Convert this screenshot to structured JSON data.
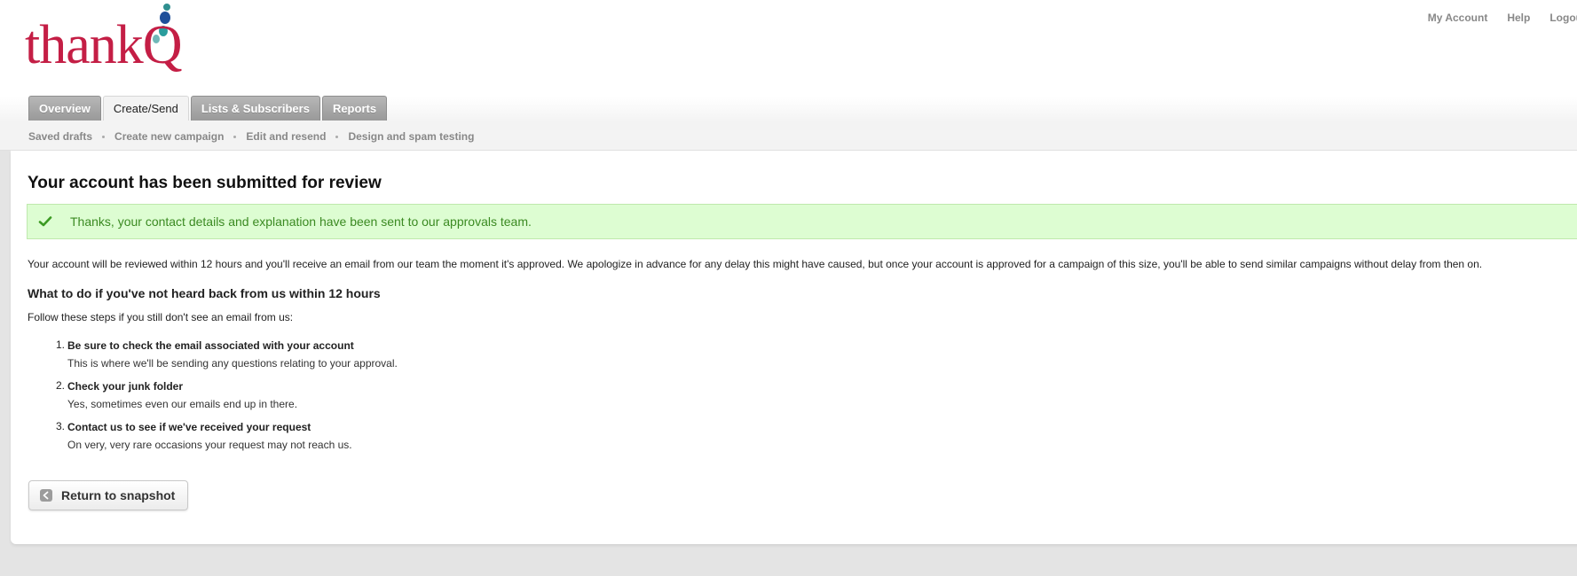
{
  "header": {
    "logo_text": "thankQ",
    "utility_nav": [
      "My Account",
      "Help",
      "Logout"
    ]
  },
  "tabs": [
    {
      "label": "Overview",
      "active": false
    },
    {
      "label": "Create/Send",
      "active": true
    },
    {
      "label": "Lists & Subscribers",
      "active": false
    },
    {
      "label": "Reports",
      "active": false
    }
  ],
  "subnav": [
    "Saved drafts",
    "Create new campaign",
    "Edit and resend",
    "Design and spam testing"
  ],
  "main": {
    "title": "Your account has been submitted for review",
    "success_message": "Thanks, your contact details and explanation have been sent to our approvals team.",
    "intro": "Your account will be reviewed within 12 hours and you'll receive an email from our team the moment it's approved. We apologize in advance for any delay this might have caused, but once your account is approved for a campaign of this size, you'll be able to send similar campaigns without delay from then on.",
    "subheading": "What to do if you've not heard back from us within 12 hours",
    "steps_intro": "Follow these steps if you still don't see an email from us:",
    "steps": [
      {
        "number": "1",
        "title": "Be sure to check the email associated with your account",
        "description": "This is where we'll be sending any questions relating to your approval."
      },
      {
        "number": "2",
        "title": "Check your junk folder",
        "description": "Yes, sometimes even our emails end up in there."
      },
      {
        "number": "3",
        "title": "Contact us to see if we've received your request",
        "description": "On very, very rare occasions your request may not reach us."
      }
    ],
    "return_button_label": "Return to snapshot"
  },
  "colors": {
    "brand": "#c41e45",
    "success_bg": "#ddfdd2",
    "success_text": "#3b8a22"
  },
  "icons": {
    "success": "checkmark-icon",
    "return": "arrow-left-icon"
  }
}
